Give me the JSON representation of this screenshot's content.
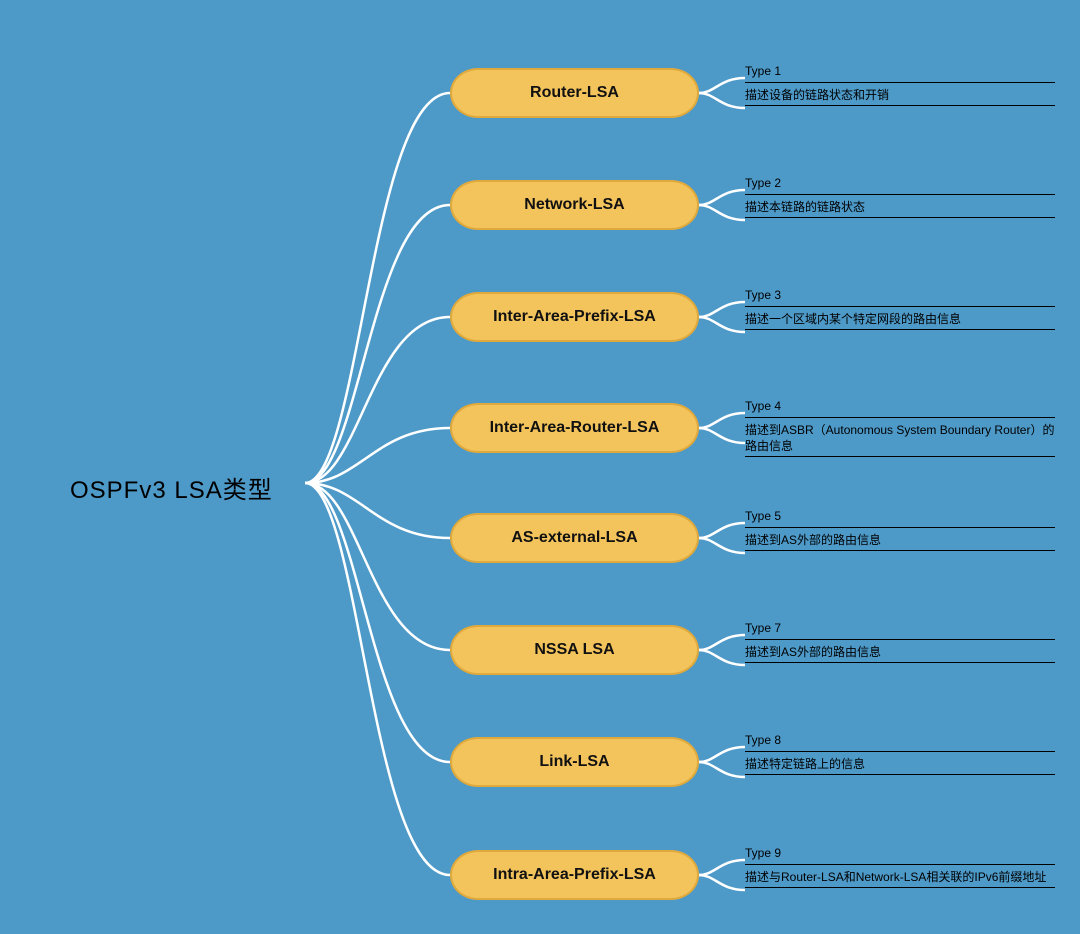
{
  "root": {
    "title": "OSPFv3 LSA类型"
  },
  "colors": {
    "background": "#4D99C8",
    "node_fill": "#F3C35C",
    "node_border": "#E0A93B",
    "connector": "#ffffff",
    "text": "#000000"
  },
  "nodes": [
    {
      "label": "Router-LSA",
      "type": "Type 1",
      "desc": "描述设备的链路状态和开销"
    },
    {
      "label": "Network-LSA",
      "type": "Type 2",
      "desc": "描述本链路的链路状态"
    },
    {
      "label": "Inter-Area-Prefix-LSA",
      "type": "Type 3",
      "desc": "描述一个区域内某个特定网段的路由信息"
    },
    {
      "label": "Inter-Area-Router-LSA",
      "type": "Type 4",
      "desc": "描述到ASBR（Autonomous System Boundary Router）的路由信息"
    },
    {
      "label": "AS-external-LSA",
      "type": "Type 5",
      "desc": "描述到AS外部的路由信息"
    },
    {
      "label": "NSSA LSA",
      "type": "Type 7",
      "desc": "描述到AS外部的路由信息"
    },
    {
      "label": "Link-LSA",
      "type": "Type 8",
      "desc": "描述特定链路上的信息"
    },
    {
      "label": "Intra-Area-Prefix-LSA",
      "type": "Type 9",
      "desc": "描述与Router-LSA和Network-LSA相关联的IPv6前缀地址"
    }
  ]
}
